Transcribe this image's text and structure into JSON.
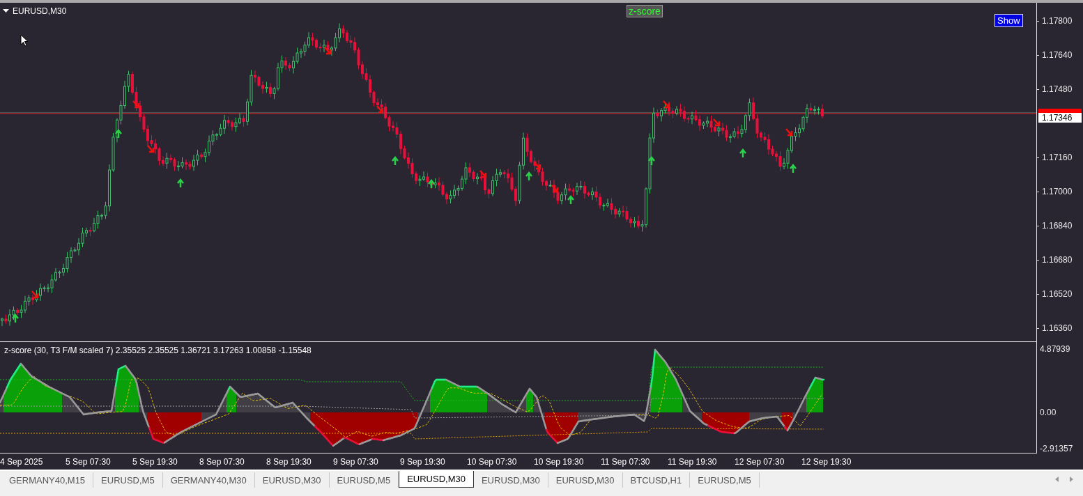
{
  "chart": {
    "title": "EURUSD,M30",
    "indicator_name": "z-score",
    "show_button": "Show",
    "price_axis": [
      "1.17800",
      "1.17640",
      "1.17480",
      "1.17160",
      "1.17000",
      "1.16840",
      "1.16680",
      "1.16520",
      "1.16360"
    ],
    "bid_label": "1.17346"
  },
  "indicator": {
    "legend": "z-score (30, T3 F/M scaled 7) 2.35525 2.35525 1.36721 3.17263 1.00858 -1.15548",
    "axis": [
      "4.87939",
      "0.00",
      "-2.91357"
    ]
  },
  "time_axis": [
    "4 Sep 2025",
    "5 Sep 07:30",
    "5 Sep 19:30",
    "8 Sep 07:30",
    "8 Sep 19:30",
    "9 Sep 07:30",
    "9 Sep 19:30",
    "10 Sep 07:30",
    "10 Sep 19:30",
    "11 Sep 07:30",
    "11 Sep 19:30",
    "12 Sep 07:30",
    "12 Sep 19:30"
  ],
  "tabs": [
    {
      "label": "GERMANY40,M15",
      "selected": false
    },
    {
      "label": "EURUSD,M5",
      "selected": false
    },
    {
      "label": "GERMANY40,M30",
      "selected": false
    },
    {
      "label": "EURUSD,M30",
      "selected": false
    },
    {
      "label": "EURUSD,M5",
      "selected": false
    },
    {
      "label": "EURUSD,M30",
      "selected": true
    },
    {
      "label": "EURUSD,M30",
      "selected": false
    },
    {
      "label": "EURUSD,M30",
      "selected": false
    },
    {
      "label": "BTCUSD,H1",
      "selected": false
    },
    {
      "label": "EURUSD,M5",
      "selected": false
    }
  ]
}
